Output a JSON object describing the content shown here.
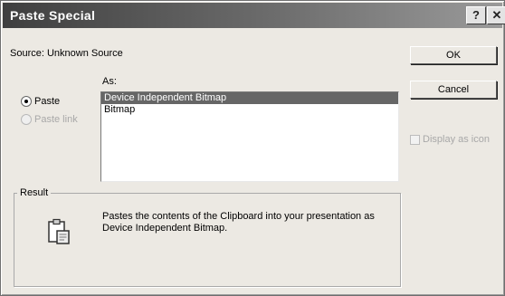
{
  "window": {
    "title": "Paste Special",
    "help_label": "?",
    "close_label": "✕"
  },
  "source": {
    "label": "Source: Unknown Source"
  },
  "options": {
    "paste_label": "Paste",
    "paste_link_label": "Paste link",
    "selected": "paste"
  },
  "as": {
    "label": "As:",
    "items": [
      {
        "label": "Device Independent Bitmap",
        "selected": true
      },
      {
        "label": "Bitmap",
        "selected": false
      }
    ]
  },
  "buttons": {
    "ok_label": "OK",
    "cancel_label": "Cancel"
  },
  "display_as_icon": {
    "label": "Display as icon",
    "checked": false,
    "enabled": false
  },
  "result": {
    "label": "Result",
    "description": "Pastes the contents of the Clipboard into your presentation as Device Independent Bitmap.",
    "icon": "clipboard-icon"
  },
  "colors": {
    "title_bar_start": "#3f3f3f",
    "title_bar_end": "#9a9a9a",
    "selection": "#666666",
    "dialog_background": "#ece9e3"
  }
}
